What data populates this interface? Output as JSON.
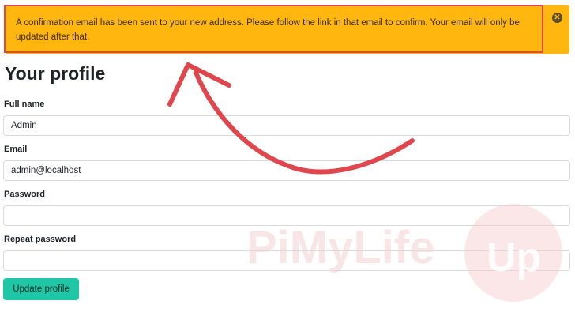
{
  "notification": {
    "message": "A confirmation email has been sent to your new address. Please follow the link in that email to confirm. Your email will only be updated after that.",
    "close_icon": "close-circle-icon",
    "color": "#ffb70f",
    "highlight_color": "#e0464c"
  },
  "page": {
    "title": "Your profile"
  },
  "form": {
    "full_name": {
      "label": "Full name",
      "value": "Admin"
    },
    "email": {
      "label": "Email",
      "value": "admin@localhost"
    },
    "password": {
      "label": "Password",
      "value": ""
    },
    "repeat_password": {
      "label": "Repeat password",
      "value": ""
    },
    "submit_label": "Update profile",
    "button_color": "#1fc7a7"
  },
  "watermark": {
    "text": "PiMyLife",
    "logo_text": "Up"
  }
}
